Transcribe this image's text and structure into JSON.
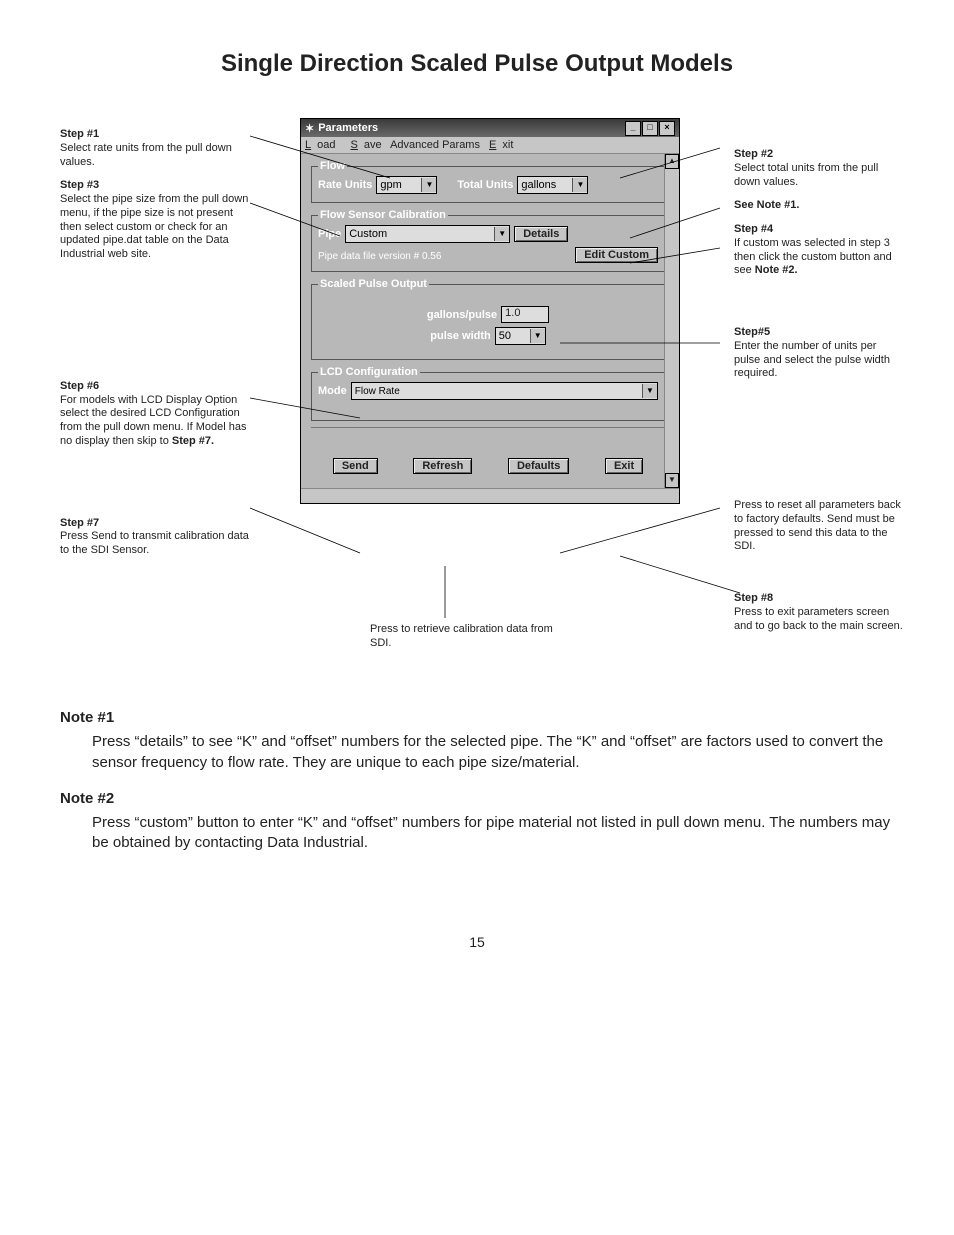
{
  "title": "Single Direction Scaled Pulse Output Models",
  "page_number": "15",
  "left": {
    "step1_h": "Step #1",
    "step1": "Select rate units from the pull down values.",
    "step3_h": "Step #3",
    "step3": "Select the pipe size from the pull down menu, if the pipe size is not present then select custom or check for an updated pipe.dat table on the Data Industrial web site.",
    "step6_h": "Step #6",
    "step6a": "For models with LCD Display Option select the desired LCD Configuration from the pull down menu. If Model has no display then skip to ",
    "step6b": "Step #7.",
    "step7_h": "Step #7",
    "step7": "Press Send to transmit calibration data to the SDI Sensor."
  },
  "right": {
    "step2_h": "Step #2",
    "step2": "Select total units from the pull down values.",
    "see_note1": "See Note #1.",
    "step4_h": "Step #4",
    "step4a": "If custom was selected in step 3 then click the custom button and see ",
    "step4b": "Note #2.",
    "step5_h": "Step#5",
    "step5": "Enter the number of units per pulse and select the pulse width required.",
    "defaults_note": "Press to reset all parameters back to factory defaults. Send must be pressed to send this data to the SDI.",
    "step8_h": "Step #8",
    "step8": "Press to exit parameters screen and to go back to the main screen."
  },
  "under": "Press to retrieve calibration data from SDI.",
  "win": {
    "title": "Parameters",
    "menu_load": "Load",
    "menu_save": "Save",
    "menu_adv": "Advanced Params",
    "menu_exit": "Exit",
    "flow_legend": "Flow",
    "rate_units_lbl": "Rate Units",
    "rate_units_val": "gpm",
    "total_units_lbl": "Total Units",
    "total_units_val": "gallons",
    "fsc_legend": "Flow Sensor Calibration",
    "pipe_lbl": "Pipe",
    "pipe_val": "Custom",
    "details_btn": "Details",
    "pipe_ver": "Pipe data file version # 0.56",
    "edit_custom_btn": "Edit Custom",
    "spo_legend": "Scaled Pulse Output",
    "gpp_lbl": "gallons/pulse",
    "gpp_val": "1.0",
    "pw_lbl": "pulse width",
    "pw_val": "50",
    "lcd_legend": "LCD Configuration",
    "mode_lbl": "Mode",
    "mode_val": "Flow Rate",
    "btn_send": "Send",
    "btn_refresh": "Refresh",
    "btn_defaults": "Defaults",
    "btn_exit": "Exit"
  },
  "notes": {
    "n1_h": "Note #1",
    "n1": "Press “details” to see “K” and “offset” numbers for the selected pipe. The “K” and “offset” are factors used to convert the sensor frequency to flow rate. They are unique to each pipe size/material.",
    "n2_h": "Note #2",
    "n2": "Press “custom” button to enter “K” and “offset” numbers for pipe material not listed in pull down menu. The numbers may be obtained by contacting Data Industrial."
  }
}
